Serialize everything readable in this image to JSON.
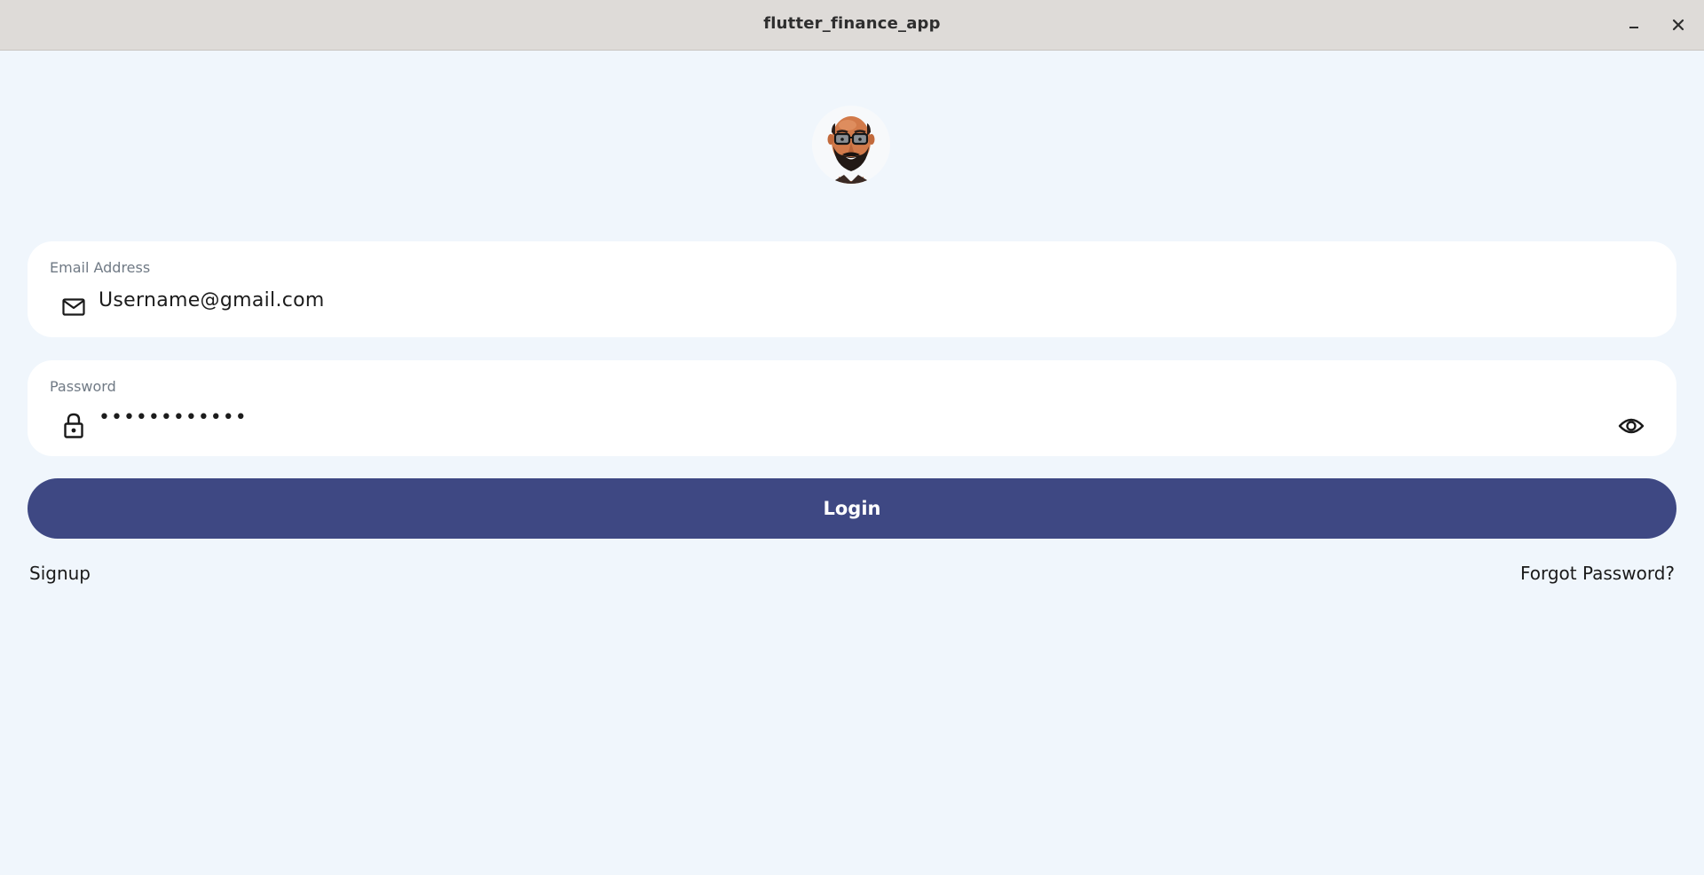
{
  "window": {
    "title": "flutter_finance_app",
    "minimize_icon": "minimize-icon",
    "close_icon": "close-icon"
  },
  "avatar": {
    "icon": "avatar-bearded-man-with-glasses"
  },
  "email_field": {
    "label": "Email Address",
    "value": "Username@gmail.com",
    "prefix_icon": "mail-icon"
  },
  "password_field": {
    "label": "Password",
    "value": "••••••••••••",
    "prefix_icon": "lock-icon",
    "suffix_icon": "eye-icon"
  },
  "login_button": {
    "label": "Login"
  },
  "links": {
    "signup": "Signup",
    "forgot_password": "Forgot Password?"
  },
  "colors": {
    "background": "#f0f6fc",
    "titlebar": "#dedbd8",
    "field_background": "#ffffff",
    "primary": "#3e4883",
    "label_text": "#707a85"
  }
}
